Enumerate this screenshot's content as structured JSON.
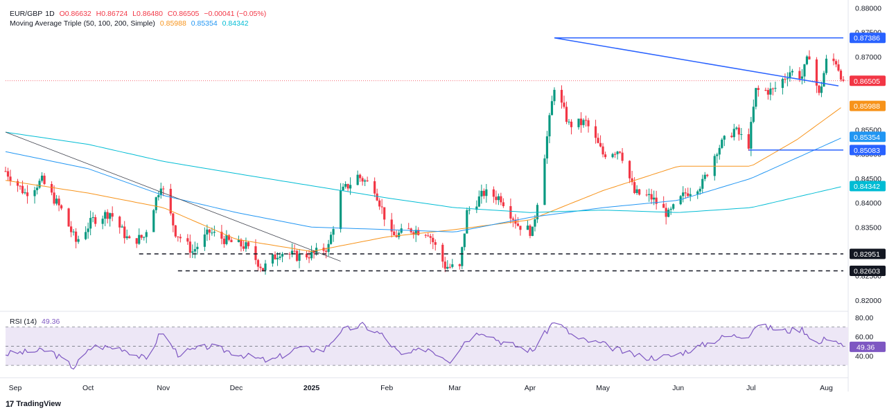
{
  "header": {
    "symbol": "EUR/GBP",
    "timeframe": "1D",
    "open": "O0.86632",
    "high": "H0.86724",
    "low": "L0.86480",
    "close": "C0.86505",
    "change": "−0.00041 (−0.05%)",
    "ma_label": "Moving Average Triple (50, 100, 200, Simple)",
    "ma50_value": "0.85988",
    "ma100_value": "0.85354",
    "ma200_value": "0.84342"
  },
  "rsi_header": {
    "label": "RSI (14)",
    "value": "49.36"
  },
  "branding": {
    "logo": "17",
    "name": "TradingView"
  },
  "colors": {
    "up": "#089981",
    "down": "#f23645",
    "ma50": "#f7931a",
    "ma100": "#2196f3",
    "ma200": "#00bcd4",
    "trend": "#2962ff",
    "rsi": "#7e57c2",
    "rsi_fill": "#ede7f6"
  },
  "chart_data": {
    "type": "candlestick",
    "title": "EUR/GBP, 1D",
    "ylim": [
      0.818,
      0.8805
    ],
    "y_ticks": [
      "0.88000",
      "0.87500",
      "0.87000",
      "0.86500",
      "0.86000",
      "0.85500",
      "0.85000",
      "0.84500",
      "0.84000",
      "0.83500",
      "0.83000",
      "0.82500",
      "0.82000"
    ],
    "x_ticks": [
      "Sep",
      "Oct",
      "Nov",
      "Dec",
      "2025",
      "Feb",
      "Mar",
      "Apr",
      "May",
      "Jun",
      "Jul",
      "Aug"
    ],
    "last_price_line": 0.86505,
    "price_labels": [
      {
        "text": "0.87386",
        "value": 0.87386,
        "color": "#2962ff"
      },
      {
        "text": "0.86505",
        "value": 0.86505,
        "color": "#f23645"
      },
      {
        "text": "0.85988",
        "value": 0.85988,
        "color": "#f7931a"
      },
      {
        "text": "0.85354",
        "value": 0.85354,
        "color": "#2196f3"
      },
      {
        "text": "0.85083",
        "value": 0.85083,
        "color": "#2962ff"
      },
      {
        "text": "0.84342",
        "value": 0.84342,
        "color": "#00bcd4"
      },
      {
        "text": "0.82951",
        "value": 0.82951,
        "color": "#131722"
      },
      {
        "text": "0.82603",
        "value": 0.82603,
        "color": "#131722"
      }
    ],
    "anchors": [
      [
        "2024-08-28",
        0.8465
      ],
      [
        "2024-09-05",
        0.842
      ],
      [
        "2024-09-12",
        0.8445
      ],
      [
        "2024-09-20",
        0.8385
      ],
      [
        "2024-09-26",
        0.832
      ],
      [
        "2024-10-03",
        0.8365
      ],
      [
        "2024-10-10",
        0.838
      ],
      [
        "2024-10-18",
        0.832
      ],
      [
        "2024-10-24",
        0.833
      ],
      [
        "2024-10-31",
        0.844
      ],
      [
        "2024-11-06",
        0.834
      ],
      [
        "2024-11-13",
        0.83
      ],
      [
        "2024-11-20",
        0.834
      ],
      [
        "2024-11-28",
        0.832
      ],
      [
        "2024-12-05",
        0.831
      ],
      [
        "2024-12-12",
        0.8265
      ],
      [
        "2024-12-19",
        0.83
      ],
      [
        "2024-12-26",
        0.829
      ],
      [
        "2025-01-02",
        0.8295
      ],
      [
        "2025-01-08",
        0.831
      ],
      [
        "2025-01-13",
        0.842
      ],
      [
        "2025-01-20",
        0.8455
      ],
      [
        "2025-01-27",
        0.843
      ],
      [
        "2025-02-03",
        0.833
      ],
      [
        "2025-02-11",
        0.8345
      ],
      [
        "2025-02-18",
        0.834
      ],
      [
        "2025-02-25",
        0.827
      ],
      [
        "2025-03-03",
        0.8265
      ],
      [
        "2025-03-06",
        0.838
      ],
      [
        "2025-03-13",
        0.842
      ],
      [
        "2025-03-20",
        0.841
      ],
      [
        "2025-03-27",
        0.8355
      ],
      [
        "2025-04-02",
        0.834
      ],
      [
        "2025-04-07",
        0.85
      ],
      [
        "2025-04-11",
        0.864
      ],
      [
        "2025-04-17",
        0.856
      ],
      [
        "2025-04-24",
        0.8565
      ],
      [
        "2025-05-01",
        0.85
      ],
      [
        "2025-05-08",
        0.851
      ],
      [
        "2025-05-14",
        0.842
      ],
      [
        "2025-05-21",
        0.841
      ],
      [
        "2025-05-28",
        0.8375
      ],
      [
        "2025-06-04",
        0.842
      ],
      [
        "2025-06-11",
        0.844
      ],
      [
        "2025-06-17",
        0.851
      ],
      [
        "2025-06-24",
        0.855
      ],
      [
        "2025-06-30",
        0.852
      ],
      [
        "2025-07-03",
        0.863
      ],
      [
        "2025-07-10",
        0.863
      ],
      [
        "2025-07-17",
        0.867
      ],
      [
        "2025-07-22",
        0.866
      ],
      [
        "2025-07-25",
        0.8705
      ],
      [
        "2025-07-29",
        0.862
      ],
      [
        "2025-08-01",
        0.869
      ],
      [
        "2025-08-05",
        0.869
      ],
      [
        "2025-08-08",
        0.865
      ]
    ],
    "series": [
      {
        "name": "MA 50",
        "points": [
          [
            "2024-08-28",
            0.8446
          ],
          [
            "2024-10-01",
            0.842
          ],
          [
            "2024-11-01",
            0.839
          ],
          [
            "2024-12-01",
            0.8325
          ],
          [
            "2025-01-01",
            0.83
          ],
          [
            "2025-02-01",
            0.833
          ],
          [
            "2025-03-01",
            0.8345
          ],
          [
            "2025-04-01",
            0.8365
          ],
          [
            "2025-05-01",
            0.8425
          ],
          [
            "2025-06-01",
            0.8475
          ],
          [
            "2025-07-01",
            0.8475
          ],
          [
            "2025-07-20",
            0.853
          ],
          [
            "2025-08-08",
            0.8599
          ]
        ]
      },
      {
        "name": "MA 100",
        "points": [
          [
            "2024-08-28",
            0.8505
          ],
          [
            "2024-10-01",
            0.847
          ],
          [
            "2024-11-01",
            0.8415
          ],
          [
            "2024-12-01",
            0.838
          ],
          [
            "2025-01-01",
            0.835
          ],
          [
            "2025-02-01",
            0.8345
          ],
          [
            "2025-03-01",
            0.834
          ],
          [
            "2025-04-01",
            0.837
          ],
          [
            "2025-05-01",
            0.839
          ],
          [
            "2025-06-01",
            0.8405
          ],
          [
            "2025-07-01",
            0.845
          ],
          [
            "2025-08-08",
            0.8535
          ]
        ]
      },
      {
        "name": "MA 200",
        "points": [
          [
            "2024-08-28",
            0.8545
          ],
          [
            "2024-10-01",
            0.852
          ],
          [
            "2024-11-01",
            0.8485
          ],
          [
            "2024-12-01",
            0.846
          ],
          [
            "2025-01-01",
            0.8435
          ],
          [
            "2025-02-01",
            0.841
          ],
          [
            "2025-03-01",
            0.839
          ],
          [
            "2025-04-01",
            0.838
          ],
          [
            "2025-05-01",
            0.8385
          ],
          [
            "2025-06-01",
            0.838
          ],
          [
            "2025-07-01",
            0.839
          ],
          [
            "2025-08-08",
            0.8434
          ]
        ]
      }
    ],
    "drawings": [
      {
        "kind": "line",
        "from": [
          "2024-08-28",
          0.8545
        ],
        "to": [
          "2025-01-13",
          0.828
        ]
      },
      {
        "kind": "line",
        "from": [
          "2025-04-11",
          0.87386
        ],
        "to": [
          "2025-08-08",
          0.87386
        ]
      },
      {
        "kind": "line",
        "from": [
          "2025-04-11",
          0.87386
        ],
        "to": [
          "2025-08-06",
          0.864
        ]
      },
      {
        "kind": "line",
        "from": [
          "2025-06-30",
          0.85083
        ],
        "to": [
          "2025-08-08",
          0.85083
        ]
      },
      {
        "kind": "dashed",
        "from": [
          "2024-10-22",
          0.82951
        ],
        "to": [
          "2025-08-08",
          0.82951
        ]
      },
      {
        "kind": "dashed",
        "from": [
          "2024-11-07",
          0.82603
        ],
        "to": [
          "2025-08-08",
          0.82603
        ]
      }
    ]
  },
  "rsi_data": {
    "type": "line",
    "ylim": [
      20,
      85
    ],
    "y_ticks": [
      "80.00",
      "60.00",
      "40.00"
    ],
    "bands": [
      70,
      50,
      30
    ],
    "value": 49.36,
    "anchors": [
      [
        "2024-08-28",
        42
      ],
      [
        "2024-09-15",
        46
      ],
      [
        "2024-09-25",
        28
      ],
      [
        "2024-10-03",
        50
      ],
      [
        "2024-10-15",
        48
      ],
      [
        "2024-10-25",
        36
      ],
      [
        "2024-10-31",
        65
      ],
      [
        "2024-11-07",
        42
      ],
      [
        "2024-11-20",
        50
      ],
      [
        "2024-12-05",
        40
      ],
      [
        "2024-12-15",
        34
      ],
      [
        "2024-12-26",
        48
      ],
      [
        "2025-01-06",
        46
      ],
      [
        "2025-01-13",
        66
      ],
      [
        "2025-01-22",
        72
      ],
      [
        "2025-01-30",
        62
      ],
      [
        "2025-02-07",
        40
      ],
      [
        "2025-02-18",
        48
      ],
      [
        "2025-02-27",
        35
      ],
      [
        "2025-03-05",
        55
      ],
      [
        "2025-03-12",
        66
      ],
      [
        "2025-03-20",
        55
      ],
      [
        "2025-04-02",
        45
      ],
      [
        "2025-04-11",
        77
      ],
      [
        "2025-04-20",
        58
      ],
      [
        "2025-05-01",
        52
      ],
      [
        "2025-05-12",
        42
      ],
      [
        "2025-05-20",
        38
      ],
      [
        "2025-05-30",
        40
      ],
      [
        "2025-06-10",
        50
      ],
      [
        "2025-06-20",
        60
      ],
      [
        "2025-06-30",
        62
      ],
      [
        "2025-07-03",
        72
      ],
      [
        "2025-07-15",
        66
      ],
      [
        "2025-07-22",
        68
      ],
      [
        "2025-07-29",
        52
      ],
      [
        "2025-08-02",
        62
      ],
      [
        "2025-08-08",
        49.36
      ]
    ]
  }
}
